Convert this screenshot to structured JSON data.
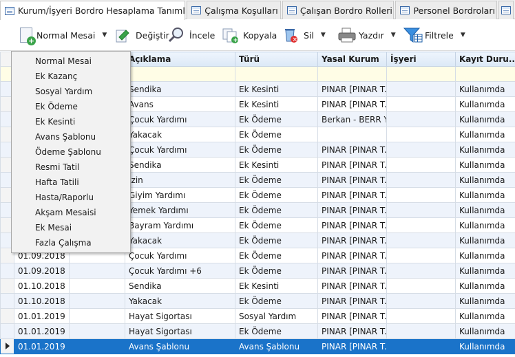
{
  "tabs": [
    {
      "label": "Kurum/İşyeri Bordro Hesaplama Tanımları",
      "active": true,
      "closable": true
    },
    {
      "label": "Çalışma Koşulları"
    },
    {
      "label": "Çalışan Bordro Rolleri"
    },
    {
      "label": "Personel Bordroları"
    }
  ],
  "toolbar": {
    "new_label": "Normal Mesai",
    "edit_label": "Değiştir",
    "view_label": "İncele",
    "copy_label": "Kopyala",
    "delete_label": "Sil",
    "print_label": "Yazdır",
    "filter_label": "Filtrele"
  },
  "icons": {
    "new": "new-document-icon",
    "edit": "edit-arrow-icon",
    "view": "magnifier-icon",
    "copy": "copy-documents-icon",
    "delete": "recycle-bin-icon",
    "print": "printer-icon",
    "filter": "funnel-icon"
  },
  "colors": {
    "selected_row": "#1a73c9",
    "alt_row": "#eef3fb",
    "filter_row": "#fffde6"
  },
  "grid": {
    "columns": [
      "",
      "",
      "Açıklama",
      "Türü",
      "Yasal Kurum",
      "İşyeri",
      "Kayıt Duru..."
    ],
    "rows": [
      [
        "",
        "",
        "Sendika",
        "Ek Kesinti",
        "PINAR [PINAR T...",
        "",
        "Kullanımda"
      ],
      [
        "",
        "",
        "Avans",
        "Ek Kesinti",
        "PINAR [PINAR T...",
        "",
        "Kullanımda"
      ],
      [
        "",
        "",
        "Çocuk Yardımı",
        "Ek Ödeme",
        "Berkan - BERR Y...",
        "",
        "Kullanımda"
      ],
      [
        "",
        "",
        "Yakacak",
        "Ek Ödeme",
        "",
        "",
        "Kullanımda"
      ],
      [
        "",
        "",
        "Çocuk Yardımı",
        "Ek Ödeme",
        "PINAR [PINAR T...",
        "",
        "Kullanımda"
      ],
      [
        "",
        "",
        "Sendika",
        "Ek Kesinti",
        "PINAR [PINAR T...",
        "",
        "Kullanımda"
      ],
      [
        "",
        "",
        "İzin",
        "Ek Ödeme",
        "PINAR [PINAR T...",
        "",
        "Kullanımda"
      ],
      [
        "",
        "",
        "Giyim Yardımı",
        "Ek Ödeme",
        "PINAR [PINAR T...",
        "",
        "Kullanımda"
      ],
      [
        "",
        "",
        "Yemek Yardımı",
        "Ek Ödeme",
        "PINAR [PINAR T...",
        "",
        "Kullanımda"
      ],
      [
        "",
        "",
        "Bayram Yardımı",
        "Ek Ödeme",
        "PINAR [PINAR T...",
        "",
        "Kullanımda"
      ],
      [
        "",
        "",
        "Yakacak",
        "Ek Ödeme",
        "PINAR [PINAR T...",
        "",
        "Kullanımda"
      ],
      [
        "01.09.2018",
        "",
        "Çocuk Yardımı",
        "Ek Ödeme",
        "PINAR [PINAR T...",
        "",
        "Kullanımda"
      ],
      [
        "01.09.2018",
        "",
        "Çocuk Yardımı +6",
        "Ek Ödeme",
        "PINAR [PINAR T...",
        "",
        "Kullanımda"
      ],
      [
        "01.10.2018",
        "",
        "Sendika",
        "Ek Kesinti",
        "PINAR [PINAR T...",
        "",
        "Kullanımda"
      ],
      [
        "01.10.2018",
        "",
        "Yakacak",
        "Ek Ödeme",
        "PINAR [PINAR T...",
        "",
        "Kullanımda"
      ],
      [
        "01.01.2019",
        "",
        "Hayat Sigortası",
        "Sosyal Yardım",
        "PINAR [PINAR T...",
        "",
        "Kullanımda"
      ],
      [
        "01.01.2019",
        "",
        "Hayat Sigortası",
        "Ek Ödeme",
        "PINAR [PINAR T...",
        "",
        "Kullanımda"
      ],
      [
        "01.01.2019",
        "",
        "Avans Şablonu",
        "Avans Şablonu",
        "PINAR [PINAR T...",
        "",
        "Kullanımda"
      ]
    ],
    "selected_row": 17
  },
  "dropdown": {
    "items": [
      "Normal Mesai",
      "Ek Kazanç",
      "Sosyal Yardım",
      "Ek Ödeme",
      "Ek Kesinti",
      "Avans Şablonu",
      "Ödeme Şablonu",
      "Resmi Tatil",
      "Hafta Tatili",
      "Hasta/Raporlu",
      "Akşam Mesaisi",
      "Ek Mesai",
      "Fazla Çalışma"
    ]
  }
}
